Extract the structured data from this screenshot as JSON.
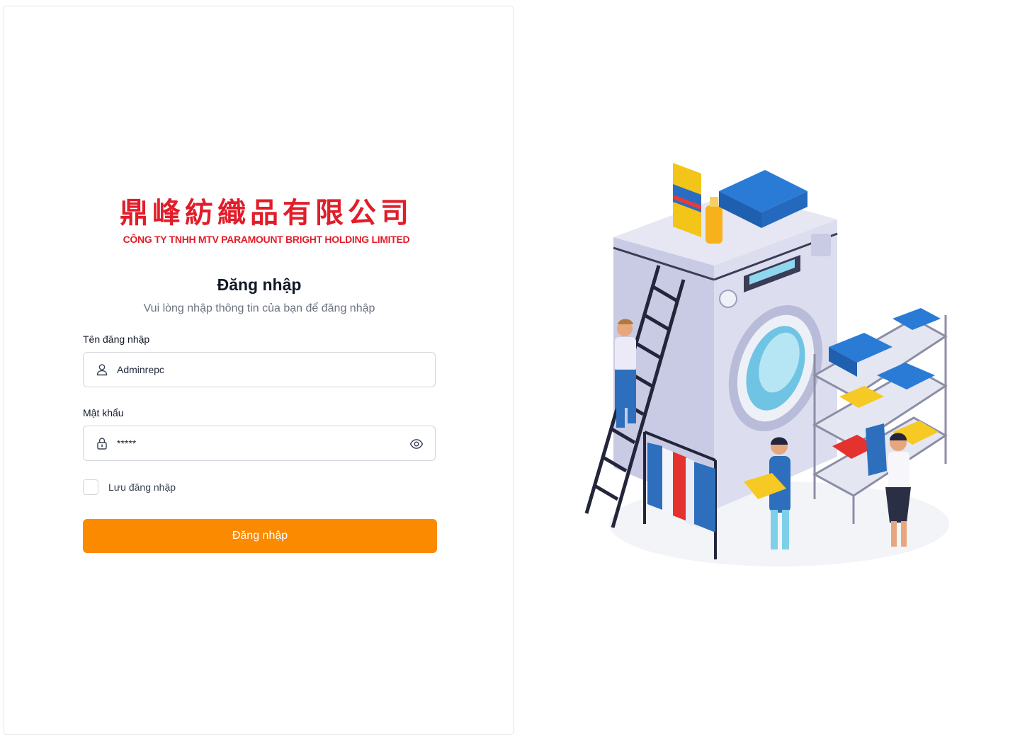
{
  "brand": {
    "cjk_name": "鼎峰紡織品有限公司",
    "company_name": "CÔNG TY TNHH MTV PARAMOUNT BRIGHT HOLDING LIMITED",
    "color": "#e11d2a"
  },
  "login": {
    "title": "Đăng nhập",
    "subtitle": "Vui lòng nhập thông tin của bạn để đăng nhập",
    "username": {
      "label": "Tên đăng nhập",
      "value": "Adminrepc",
      "icon": "user-icon"
    },
    "password": {
      "label": "Mật khẩu",
      "value": "*****",
      "icon": "lock-icon",
      "toggle_icon": "eye-icon"
    },
    "remember_label": "Lưu đăng nhập",
    "remember_checked": false,
    "submit_label": "Đăng nhập",
    "accent_color": "#fb8a00"
  },
  "illustration": {
    "subject": "laundry-washing-machine-illustration"
  }
}
